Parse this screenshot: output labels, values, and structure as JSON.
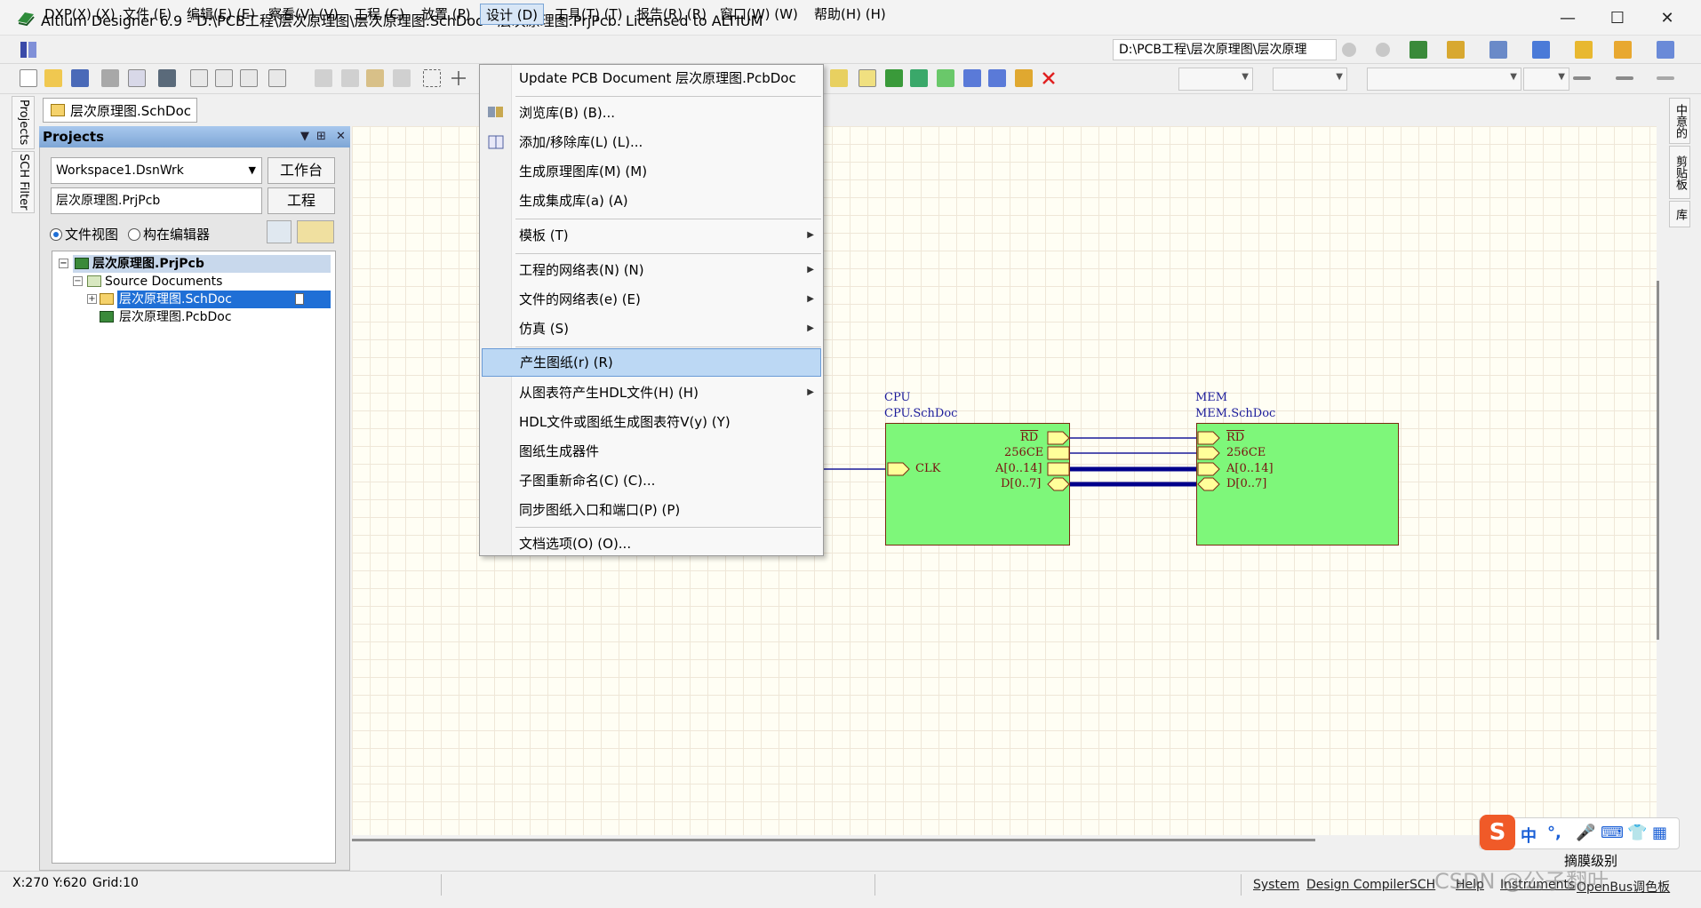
{
  "window": {
    "title": "Altium Designer 6.9 - D:\\PCB工程\\层次原理图\\层次原理图.SchDoc - 层次原理图.PrjPcb. Licensed to ALTIUM",
    "minimize": "—",
    "maximize": "☐",
    "close": "✕"
  },
  "menubar": {
    "items": [
      {
        "label": "DXP(X) (X)"
      },
      {
        "label": "文件 (F)"
      },
      {
        "label": "编辑(E) (E)"
      },
      {
        "label": "察看(V) (V)"
      },
      {
        "label": "工程 (C)"
      },
      {
        "label": "放置 (P)"
      },
      {
        "label": "设计 (D)"
      },
      {
        "label": "工具(T) (T)"
      },
      {
        "label": "报告(R) (R)"
      },
      {
        "label": "窗口(W) (W)"
      },
      {
        "label": "帮助(H) (H)"
      }
    ],
    "path": "D:\\PCB工程\\层次原理图\\层次原理"
  },
  "doc_tab": {
    "label": "层次原理图.SchDoc"
  },
  "left_tabs": [
    "Projects",
    "SCH Filter"
  ],
  "right_tabs": [
    "中意的",
    "剪贴板",
    "库"
  ],
  "panel": {
    "title": "Projects",
    "workspace": "Workspace1.DsnWrk",
    "workspace_btn": "工作台",
    "project": "层次原理图.PrjPcb",
    "project_btn": "工程",
    "view_file": "文件视图",
    "view_struct": "构在编辑器",
    "tree": {
      "project": "层次原理图.PrjPcb",
      "folder": "Source Documents",
      "schdoc": "层次原理图.SchDoc",
      "pcbdoc": "层次原理图.PcbDoc"
    }
  },
  "design_menu": {
    "items": [
      {
        "label": "Update PCB Document 层次原理图.PcbDoc",
        "submenu": false
      },
      {
        "label": "浏览库(B) (B)...",
        "submenu": false
      },
      {
        "label": "添加/移除库(L) (L)...",
        "submenu": false
      },
      {
        "label": "生成原理图库(M) (M)",
        "submenu": false
      },
      {
        "label": "生成集成库(a) (A)",
        "submenu": false
      },
      {
        "label": "模板 (T)",
        "submenu": true
      },
      {
        "label": "工程的网络表(N) (N)",
        "submenu": true
      },
      {
        "label": "文件的网络表(e) (E)",
        "submenu": true
      },
      {
        "label": "仿真 (S)",
        "submenu": true
      },
      {
        "label": "产生图纸(r) (R)",
        "submenu": false,
        "highlighted": true
      },
      {
        "label": "从图表符产生HDL文件(H) (H)",
        "submenu": true
      },
      {
        "label": "HDL文件或图纸生成图表符V(y) (Y)",
        "submenu": false
      },
      {
        "label": "图纸生成器件",
        "submenu": false
      },
      {
        "label": "子图重新命名(C) (C)...",
        "submenu": false
      },
      {
        "label": "同步图纸入口和端口(P) (P)",
        "submenu": false
      },
      {
        "label": "文档选项(O) (O)...",
        "submenu": false
      }
    ],
    "submenu_arrow": "▶"
  },
  "schematic": {
    "cpu": {
      "designator": "CPU",
      "filename": "CPU.SchDoc",
      "entries": [
        "RD",
        "256CE",
        "A[0..14]",
        "D[0..7]"
      ],
      "clk": "CLK"
    },
    "mem": {
      "designator": "MEM",
      "filename": "MEM.SchDoc",
      "entries": [
        "RD",
        "256CE",
        "A[0..14]",
        "D[0..7]"
      ]
    },
    "colors": {
      "sheet_fill": "#7ef77a",
      "sheet_border": "#7a2a10",
      "wire": "#1a1a9a",
      "bus": "#00008b",
      "entry_fill": "#ffff9a"
    }
  },
  "statusbar": {
    "coords": "X:270 Y:620",
    "grid": "Grid:10",
    "buttons": [
      "System",
      "Design Compiler",
      "SCH",
      "Help",
      "Instruments",
      "OpenBus调色板"
    ]
  },
  "ime": {
    "logo": "S",
    "mode": "中",
    "extra": "摘膜级别"
  },
  "watermark": "CSDN @公子翻叶",
  "icons": [
    "app-logo-icon",
    "dxp-logo-icon",
    "new-icon",
    "open-icon",
    "save-icon",
    "print-icon",
    "preview-icon",
    "zoom-icon",
    "cut-icon",
    "copy-icon",
    "paste-icon",
    "select-icon",
    "cross-icon",
    "vcc-icon",
    "port-icon",
    "close-x-icon",
    "nav-back-icon",
    "nav-forward-icon",
    "pin-icon",
    "close-icon"
  ]
}
